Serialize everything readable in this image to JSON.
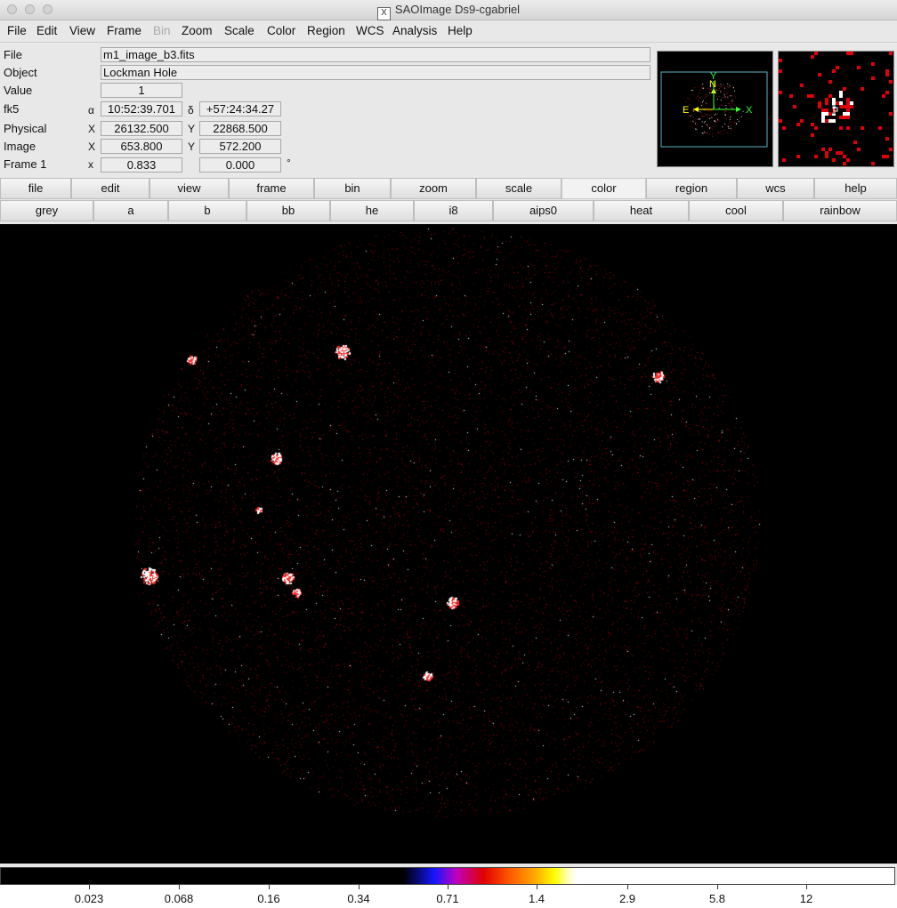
{
  "window": {
    "title": "SAOImage Ds9-cgabriel"
  },
  "menu": [
    "File",
    "Edit",
    "View",
    "Frame",
    "Bin",
    "Zoom",
    "Scale",
    "Color",
    "Region",
    "WCS",
    "Analysis",
    "Help"
  ],
  "menu_disabled": "Bin",
  "info": {
    "file_label": "File",
    "file_value": "m1_image_b3.fits",
    "object_label": "Object",
    "object_value": "Lockman Hole",
    "value_label": "Value",
    "value_value": "1",
    "fk5_label": "fk5",
    "alpha_sym": "α",
    "alpha_value": "10:52:39.701",
    "delta_sym": "δ",
    "delta_value": "+57:24:34.27",
    "physical_label": "Physical",
    "phys_x_sym": "X",
    "phys_x": "26132.500",
    "phys_y_sym": "Y",
    "phys_y": "22868.500",
    "image_label": "Image",
    "img_x_sym": "X",
    "img_x": "653.800",
    "img_y_sym": "Y",
    "img_y": "572.200",
    "frame_label": "Frame 1",
    "frame_x_sym": "x",
    "frame_zoom": "0.833",
    "frame_angle": "0.000",
    "deg_sym": "°"
  },
  "panner": {
    "north": "N",
    "east": "E",
    "x": "X",
    "y": "Y"
  },
  "buttonbar": [
    "file",
    "edit",
    "view",
    "frame",
    "bin",
    "zoom",
    "scale",
    "color",
    "region",
    "wcs",
    "help"
  ],
  "buttonbar_active": "color",
  "colormaps": [
    "grey",
    "a",
    "b",
    "bb",
    "he",
    "i8",
    "aips0",
    "heat",
    "cool",
    "rainbow"
  ],
  "colorbar_ticks": [
    "0.023",
    "0.068",
    "0.16",
    "0.34",
    "0.71",
    "1.4",
    "2.9",
    "5.8",
    "12"
  ],
  "colors": {
    "accent_line": "#59b6c4",
    "compass": "#ffff00",
    "axes": "#33ff33",
    "heat_red": "#e0000a"
  }
}
